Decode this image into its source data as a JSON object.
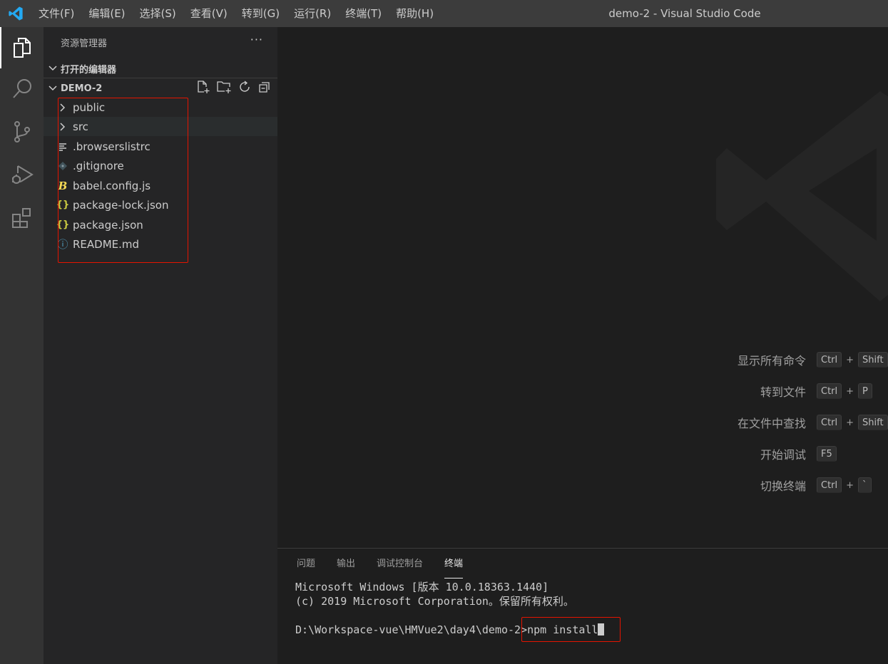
{
  "titlebar": {
    "menu": [
      "文件(F)",
      "编辑(E)",
      "选择(S)",
      "查看(V)",
      "转到(G)",
      "运行(R)",
      "终端(T)",
      "帮助(H)"
    ],
    "window_title": "demo-2 - Visual Studio Code"
  },
  "activitybar": {
    "items": [
      "explorer-icon",
      "search-icon",
      "source-control-icon",
      "run-debug-icon",
      "extensions-icon"
    ]
  },
  "sidebar": {
    "title": "资源管理器",
    "more": "···",
    "open_editors": "打开的编辑器",
    "project": "DEMO-2",
    "tree": [
      {
        "label": "public",
        "icon": "chevron-right-icon"
      },
      {
        "label": "src",
        "icon": "chevron-right-icon"
      },
      {
        "label": ".browserslistrc",
        "icon": "file-lines-icon"
      },
      {
        "label": ".gitignore",
        "icon": "git-diamond-icon"
      },
      {
        "label": "babel.config.js",
        "icon": "babel-icon",
        "glyph": "B"
      },
      {
        "label": "package-lock.json",
        "icon": "json-icon",
        "glyph": "{}"
      },
      {
        "label": "package.json",
        "icon": "json-icon",
        "glyph": "{}"
      },
      {
        "label": "README.md",
        "icon": "info-icon",
        "glyph": "ⓘ"
      }
    ]
  },
  "editor": {
    "shortcuts": [
      {
        "label": "显示所有命令",
        "keys": [
          "Ctrl",
          "Shift"
        ]
      },
      {
        "label": "转到文件",
        "keys": [
          "Ctrl",
          "P"
        ]
      },
      {
        "label": "在文件中查找",
        "keys": [
          "Ctrl",
          "Shift"
        ]
      },
      {
        "label": "开始调试",
        "keys": [
          "F5"
        ]
      },
      {
        "label": "切换终端",
        "keys": [
          "Ctrl",
          "`"
        ]
      }
    ],
    "plus": "+"
  },
  "panel": {
    "tabs": [
      "问题",
      "输出",
      "调试控制台",
      "终端"
    ],
    "active_tab": "终端",
    "terminal": {
      "line1": "Microsoft Windows [版本 10.0.18363.1440]",
      "line2": "(c) 2019 Microsoft Corporation。保留所有权利。",
      "prompt": "D:\\Workspace-vue\\HMVue2\\day4\\demo-2>",
      "command": "npm install"
    }
  },
  "colors": {
    "accent": "#23a9f2",
    "highlight_box": "#e51400",
    "json_icon": "#cbcb41",
    "info_icon": "#519aba"
  }
}
